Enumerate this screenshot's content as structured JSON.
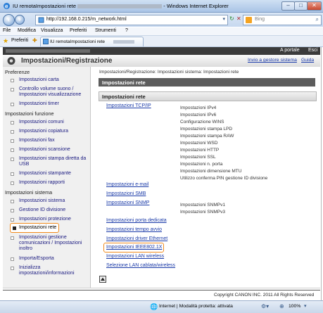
{
  "window": {
    "title": "IU remotaImpostazioni rete",
    "app_suffix": "- Windows Internet Explorer",
    "controls": {
      "minimize": "–",
      "maximize": "□",
      "close": "✕"
    }
  },
  "address_bar": {
    "url": "http://192.168.0.215/m_network.html",
    "search_placeholder": "Bing"
  },
  "menu": [
    "File",
    "Modifica",
    "Visualizza",
    "Preferiti",
    "Strumenti",
    "?"
  ],
  "favorites": {
    "label": "Preferiti",
    "tab_title": "IU remotaImpostazioni rete"
  },
  "page_header": {
    "portal_link": "A portale",
    "exit_link": "Esci",
    "title": "Impostazioni/Registrazione",
    "admin_link": "Invio a gestore sistema",
    "help_link": "Guida"
  },
  "sidebar": {
    "sections": [
      {
        "label": "Preferenze",
        "items": [
          "Impostazioni carta",
          "Controllo volume suono / Impostazioni visualizzazione",
          "Impostazioni timer"
        ]
      },
      {
        "label": "Impostazioni funzione",
        "items": [
          "Impostazioni comuni",
          "Impostazioni copiatura",
          "Impostazioni fax",
          "Impostazioni scansione",
          "Impostazioni stampa diretta da USB",
          "Impostazioni stampante",
          "Impostazioni rapporti"
        ]
      },
      {
        "label": "Impostazioni sistema",
        "items": [
          "Impostazioni sistema",
          "Gestione ID divisione",
          "Impostazioni protezione",
          "Impostazioni rete",
          "Impostazioni gestione comunicazioni / Impostazioni inoltro",
          "Importa/Esporta",
          "Inizializza impostazioni/informazioni"
        ]
      }
    ],
    "selected": "Impostazioni rete"
  },
  "content": {
    "breadcrumb": "Impostazioni/Registrazione: Impostazioni sistema: Impostazioni rete",
    "page_title": "Impostazioni rete",
    "section_title": "Impostazioni rete",
    "tcpip_link": "Impostazioni TCP/IP",
    "tcpip_items": [
      "Impostazioni IPv4",
      "Impostazioni IPv6",
      "Configurazione WINS",
      "Impostazioni stampa LPD",
      "Impostazioni stampa RAW",
      "Impostazioni WSD",
      "Impostazioni HTTP",
      "Impostazioni SSL",
      "Impostazioni n. porta",
      "Impostazioni dimensione MTU",
      "Utilizzo conferma PIN gestione ID divisione"
    ],
    "email_link": "Impostazioni e-mail",
    "smb_link": "Impostazioni SMB",
    "snmp_link": "Impostazioni SNMP",
    "snmp_items": [
      "Impostazioni SNMPv1",
      "Impostazioni SNMPv3"
    ],
    "port_link": "Impostazioni porta dedicata",
    "startup_link": "Impostazioni tempo avvio",
    "ethernet_link": "Impostazioni driver Ethernet",
    "ieee_link": "Impostazioni IEEE802.1X",
    "wlan_link": "Impostazioni LAN wireless",
    "select_lan_link": "Selezione LAN cablata/wireless",
    "top_icon": "page-top-icon"
  },
  "footer": {
    "copyright": "Copyright CANON INC. 2011 All Rights Reserved"
  },
  "status": {
    "zone": "Internet | Modalità protetta: attivata",
    "zoom": "100%"
  },
  "colors": {
    "highlight": "#f08a1c",
    "link": "#1a3aa8",
    "title_bar": "#5c5c5c"
  }
}
